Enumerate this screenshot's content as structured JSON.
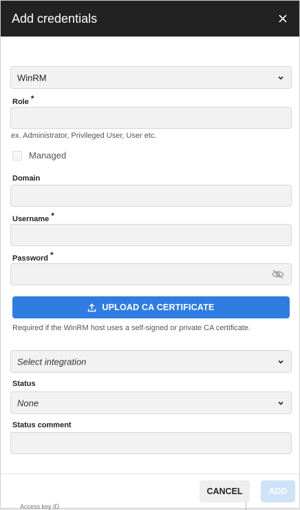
{
  "dialog": {
    "title": "Add credentials"
  },
  "form": {
    "type_select": {
      "value": "WinRM"
    },
    "role": {
      "label": "Role",
      "required": "*",
      "value": "",
      "hint": "ex. Administrator, Privileged User, User etc."
    },
    "managed": {
      "label": "Managed",
      "checked": false
    },
    "domain": {
      "label": "Domain",
      "value": ""
    },
    "username": {
      "label": "Username",
      "required": "*",
      "value": ""
    },
    "password": {
      "label": "Password",
      "required": "*",
      "value": "",
      "icon": "eye-off-icon"
    },
    "upload": {
      "label": "UPLOAD CA CERTIFICATE",
      "icon": "upload-icon",
      "hint": "Required if the WinRM host uses a self-signed or private CA certificate."
    },
    "integration_select": {
      "placeholder": "Select integration"
    },
    "status": {
      "label": "Status",
      "value": "None"
    },
    "status_comment": {
      "label": "Status comment",
      "value": ""
    }
  },
  "footer": {
    "cancel_label": "CANCEL",
    "add_label": "ADD"
  },
  "background": {
    "peek_text": "Access key ID"
  },
  "colors": {
    "titlebar": "#222222",
    "accent": "#2f7de1",
    "add_disabled": "#cfe2f8"
  }
}
